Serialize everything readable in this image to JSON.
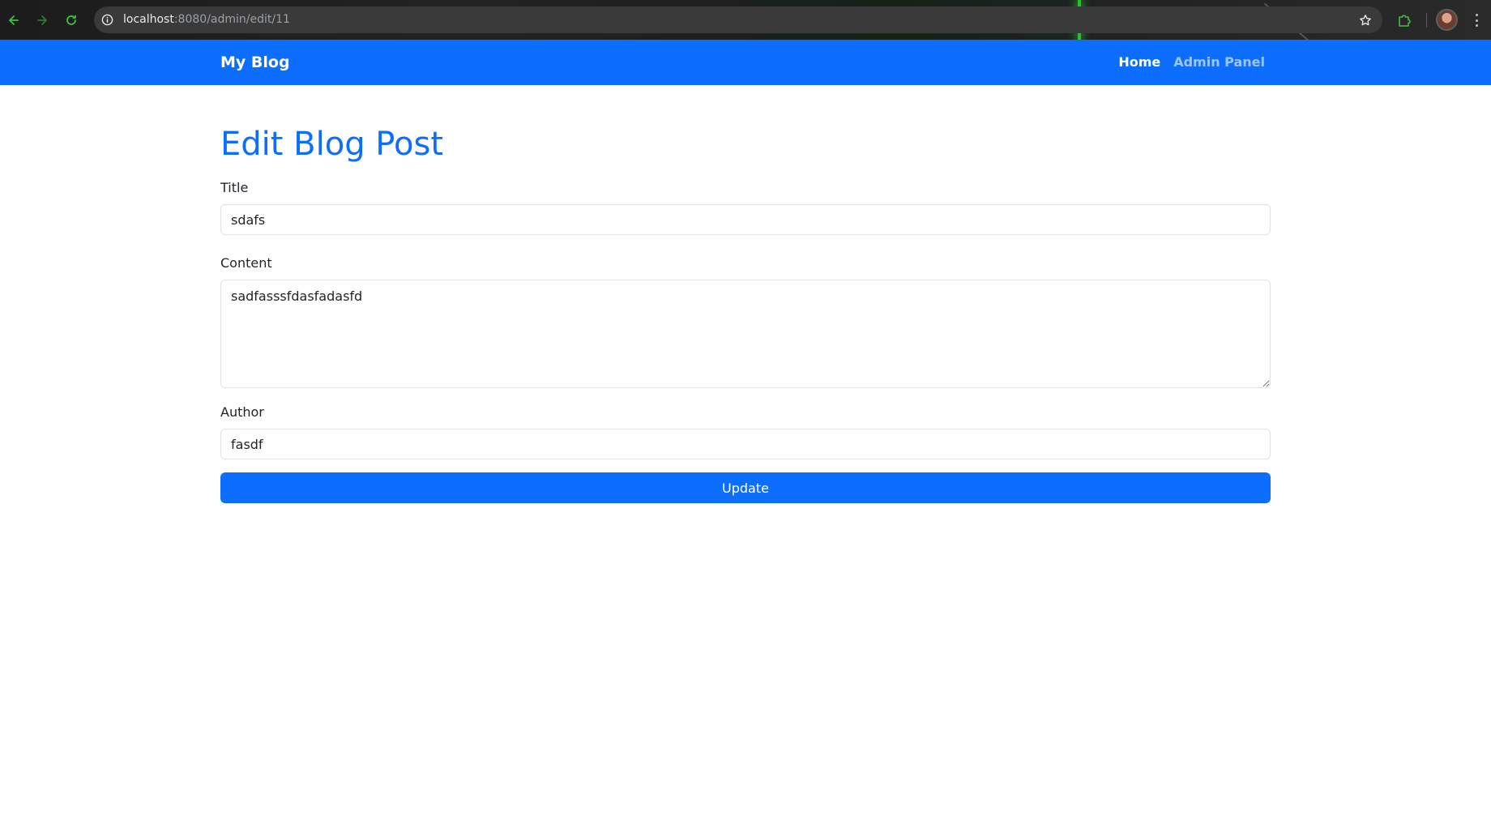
{
  "browser": {
    "url_host": "localhost",
    "url_path": ":8080/admin/edit/11",
    "icons": {
      "back": "arrow-left-icon",
      "forward": "arrow-right-icon",
      "reload": "reload-icon",
      "site_info": "info-icon",
      "bookmark": "star-icon",
      "extensions": "puzzle-icon",
      "menu": "more-vert-icon"
    }
  },
  "navbar": {
    "brand": "My Blog",
    "links": [
      {
        "label": "Home",
        "active": true
      },
      {
        "label": "Admin Panel",
        "active": false
      }
    ],
    "background": "#0d6efd"
  },
  "form": {
    "heading": "Edit Blog Post",
    "title_label": "Title",
    "title_value": "sdafs",
    "content_label": "Content",
    "content_value": "sadfasssfdasfadasfd",
    "author_label": "Author",
    "author_value": "fasdf",
    "submit_label": "Update"
  },
  "colors": {
    "primary": "#0d6efd",
    "text": "#212529",
    "border": "#dee2e6"
  }
}
